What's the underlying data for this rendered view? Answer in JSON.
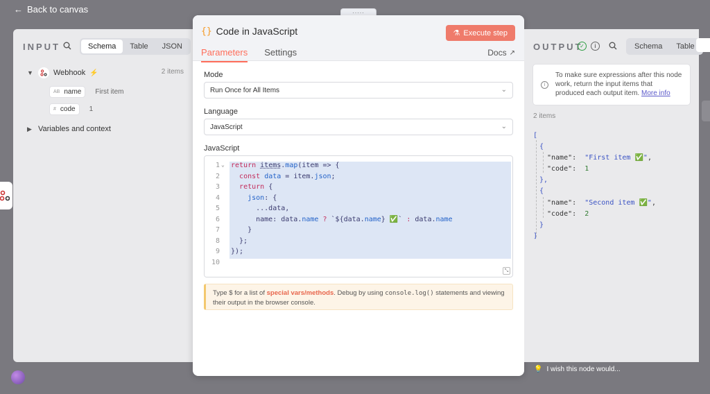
{
  "app": {
    "back_label": "Back to canvas",
    "drag_handle": ":::::",
    "wish_text": "I wish this node would..."
  },
  "input_panel": {
    "title": "INPUT",
    "view_options": [
      "Schema",
      "Table",
      "JSON"
    ],
    "active_view": "Schema",
    "node_name": "Webhook",
    "item_count": "2 items",
    "fields": [
      {
        "type_icon": "AB",
        "name": "name",
        "value": "First item"
      },
      {
        "type_icon": "#",
        "name": "code",
        "value": "1"
      }
    ],
    "variables_label": "Variables and context"
  },
  "modal": {
    "icon": "{}",
    "title": "Code in JavaScript",
    "execute_label": "Execute step",
    "tabs": [
      "Parameters",
      "Settings"
    ],
    "active_tab": "Parameters",
    "docs_label": "Docs",
    "mode_label": "Mode",
    "mode_value": "Run Once for All Items",
    "language_label": "Language",
    "language_value": "JavaScript",
    "code_label": "JavaScript",
    "hint_prefix": "Type $ for a list of ",
    "hint_accent": "special vars/methods",
    "hint_mid": ". Debug by using ",
    "hint_code": "console.log()",
    "hint_suffix": " statements and viewing their output in the browser console."
  },
  "output_panel": {
    "title": "OUTPUT",
    "view_options": [
      "Schema",
      "Table"
    ],
    "notice_text": "To make sure expressions after this node work, return the input items that produced each output item.",
    "notice_link": "More info",
    "item_count": "2 items",
    "items": [
      {
        "name": "First item ✅",
        "code": "1"
      },
      {
        "name": "Second item ✅",
        "code": "2"
      }
    ]
  },
  "colors": {
    "accent": "#ff6d5a",
    "execute_button": "#ef7b6b",
    "code_keyword": "#c32b5a",
    "code_property": "#2463c9",
    "json_string": "#3b53c4"
  }
}
